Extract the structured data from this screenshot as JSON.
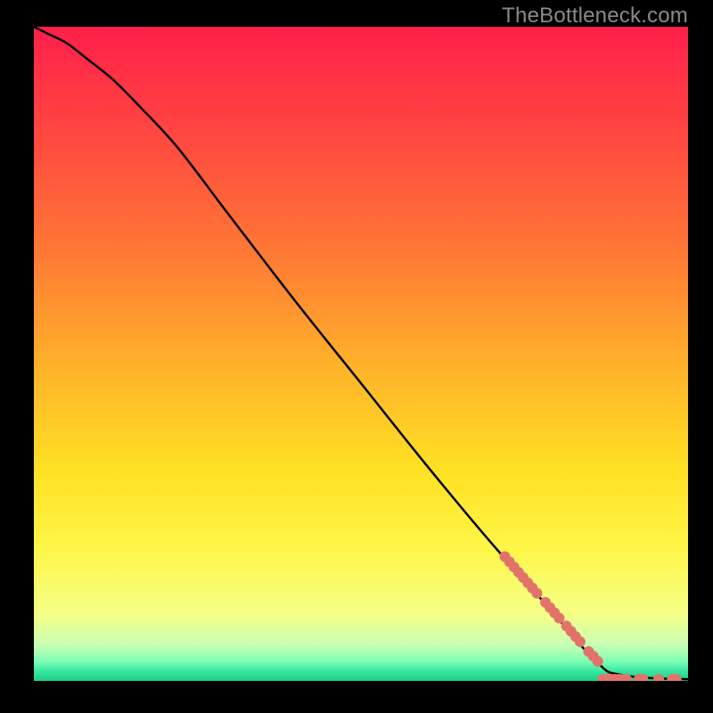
{
  "watermark": "TheBottleneck.com",
  "chart_data": {
    "type": "line",
    "title": "",
    "xlabel": "",
    "ylabel": "",
    "xlim": [
      0,
      100
    ],
    "ylim": [
      0,
      100
    ],
    "grid": false,
    "legend": false,
    "background_gradient_stops": [
      {
        "offset": 0.0,
        "color": "#ff1f4b"
      },
      {
        "offset": 0.18,
        "color": "#ff4b3f"
      },
      {
        "offset": 0.35,
        "color": "#ff7a35"
      },
      {
        "offset": 0.52,
        "color": "#ffb22a"
      },
      {
        "offset": 0.68,
        "color": "#ffe123"
      },
      {
        "offset": 0.8,
        "color": "#fff64a"
      },
      {
        "offset": 0.9,
        "color": "#f4ff88"
      },
      {
        "offset": 0.945,
        "color": "#c8ffb4"
      },
      {
        "offset": 0.97,
        "color": "#7dffb4"
      },
      {
        "offset": 0.985,
        "color": "#38e6a0"
      },
      {
        "offset": 1.0,
        "color": "#1ecf87"
      }
    ],
    "series": [
      {
        "name": "bottleneck-curve",
        "color": "#000000",
        "stroke_width": 2.5,
        "x": [
          0,
          2,
          5,
          8,
          12,
          16,
          22,
          30,
          40,
          50,
          60,
          70,
          78,
          84,
          86,
          87,
          88,
          90,
          92,
          95,
          98,
          100
        ],
        "values": [
          100,
          99,
          97.5,
          95.2,
          92,
          88,
          81.5,
          71,
          58,
          45.5,
          33,
          21,
          12,
          5,
          3,
          2,
          1.3,
          0.9,
          0.6,
          0.4,
          0.3,
          0.25
        ]
      }
    ],
    "markers": {
      "name": "highlight-segments",
      "color": "#e2736b",
      "radius": 6,
      "diag_points": [
        {
          "x": 72.0,
          "y": 19.0
        },
        {
          "x": 72.7,
          "y": 18.2
        },
        {
          "x": 73.4,
          "y": 17.4
        },
        {
          "x": 74.1,
          "y": 16.6
        },
        {
          "x": 74.8,
          "y": 15.8
        },
        {
          "x": 75.5,
          "y": 15.0
        },
        {
          "x": 76.2,
          "y": 14.2
        },
        {
          "x": 76.9,
          "y": 13.4
        },
        {
          "x": 78.2,
          "y": 12.0
        },
        {
          "x": 78.9,
          "y": 11.2
        },
        {
          "x": 79.6,
          "y": 10.4
        },
        {
          "x": 80.3,
          "y": 9.6
        },
        {
          "x": 81.4,
          "y": 8.4
        },
        {
          "x": 82.1,
          "y": 7.6
        },
        {
          "x": 82.8,
          "y": 6.8
        },
        {
          "x": 83.5,
          "y": 6.0
        },
        {
          "x": 84.8,
          "y": 4.5
        },
        {
          "x": 85.5,
          "y": 3.8
        },
        {
          "x": 86.2,
          "y": 3.0
        }
      ],
      "flat_points": [
        {
          "x": 87.0,
          "y": 0.25
        },
        {
          "x": 87.6,
          "y": 0.25
        },
        {
          "x": 88.2,
          "y": 0.25
        },
        {
          "x": 88.8,
          "y": 0.25
        },
        {
          "x": 89.4,
          "y": 0.25
        },
        {
          "x": 90.0,
          "y": 0.25
        },
        {
          "x": 90.6,
          "y": 0.25
        },
        {
          "x": 92.5,
          "y": 0.25
        },
        {
          "x": 93.1,
          "y": 0.25
        },
        {
          "x": 95.5,
          "y": 0.25
        },
        {
          "x": 97.6,
          "y": 0.25
        },
        {
          "x": 98.2,
          "y": 0.25
        }
      ]
    }
  }
}
